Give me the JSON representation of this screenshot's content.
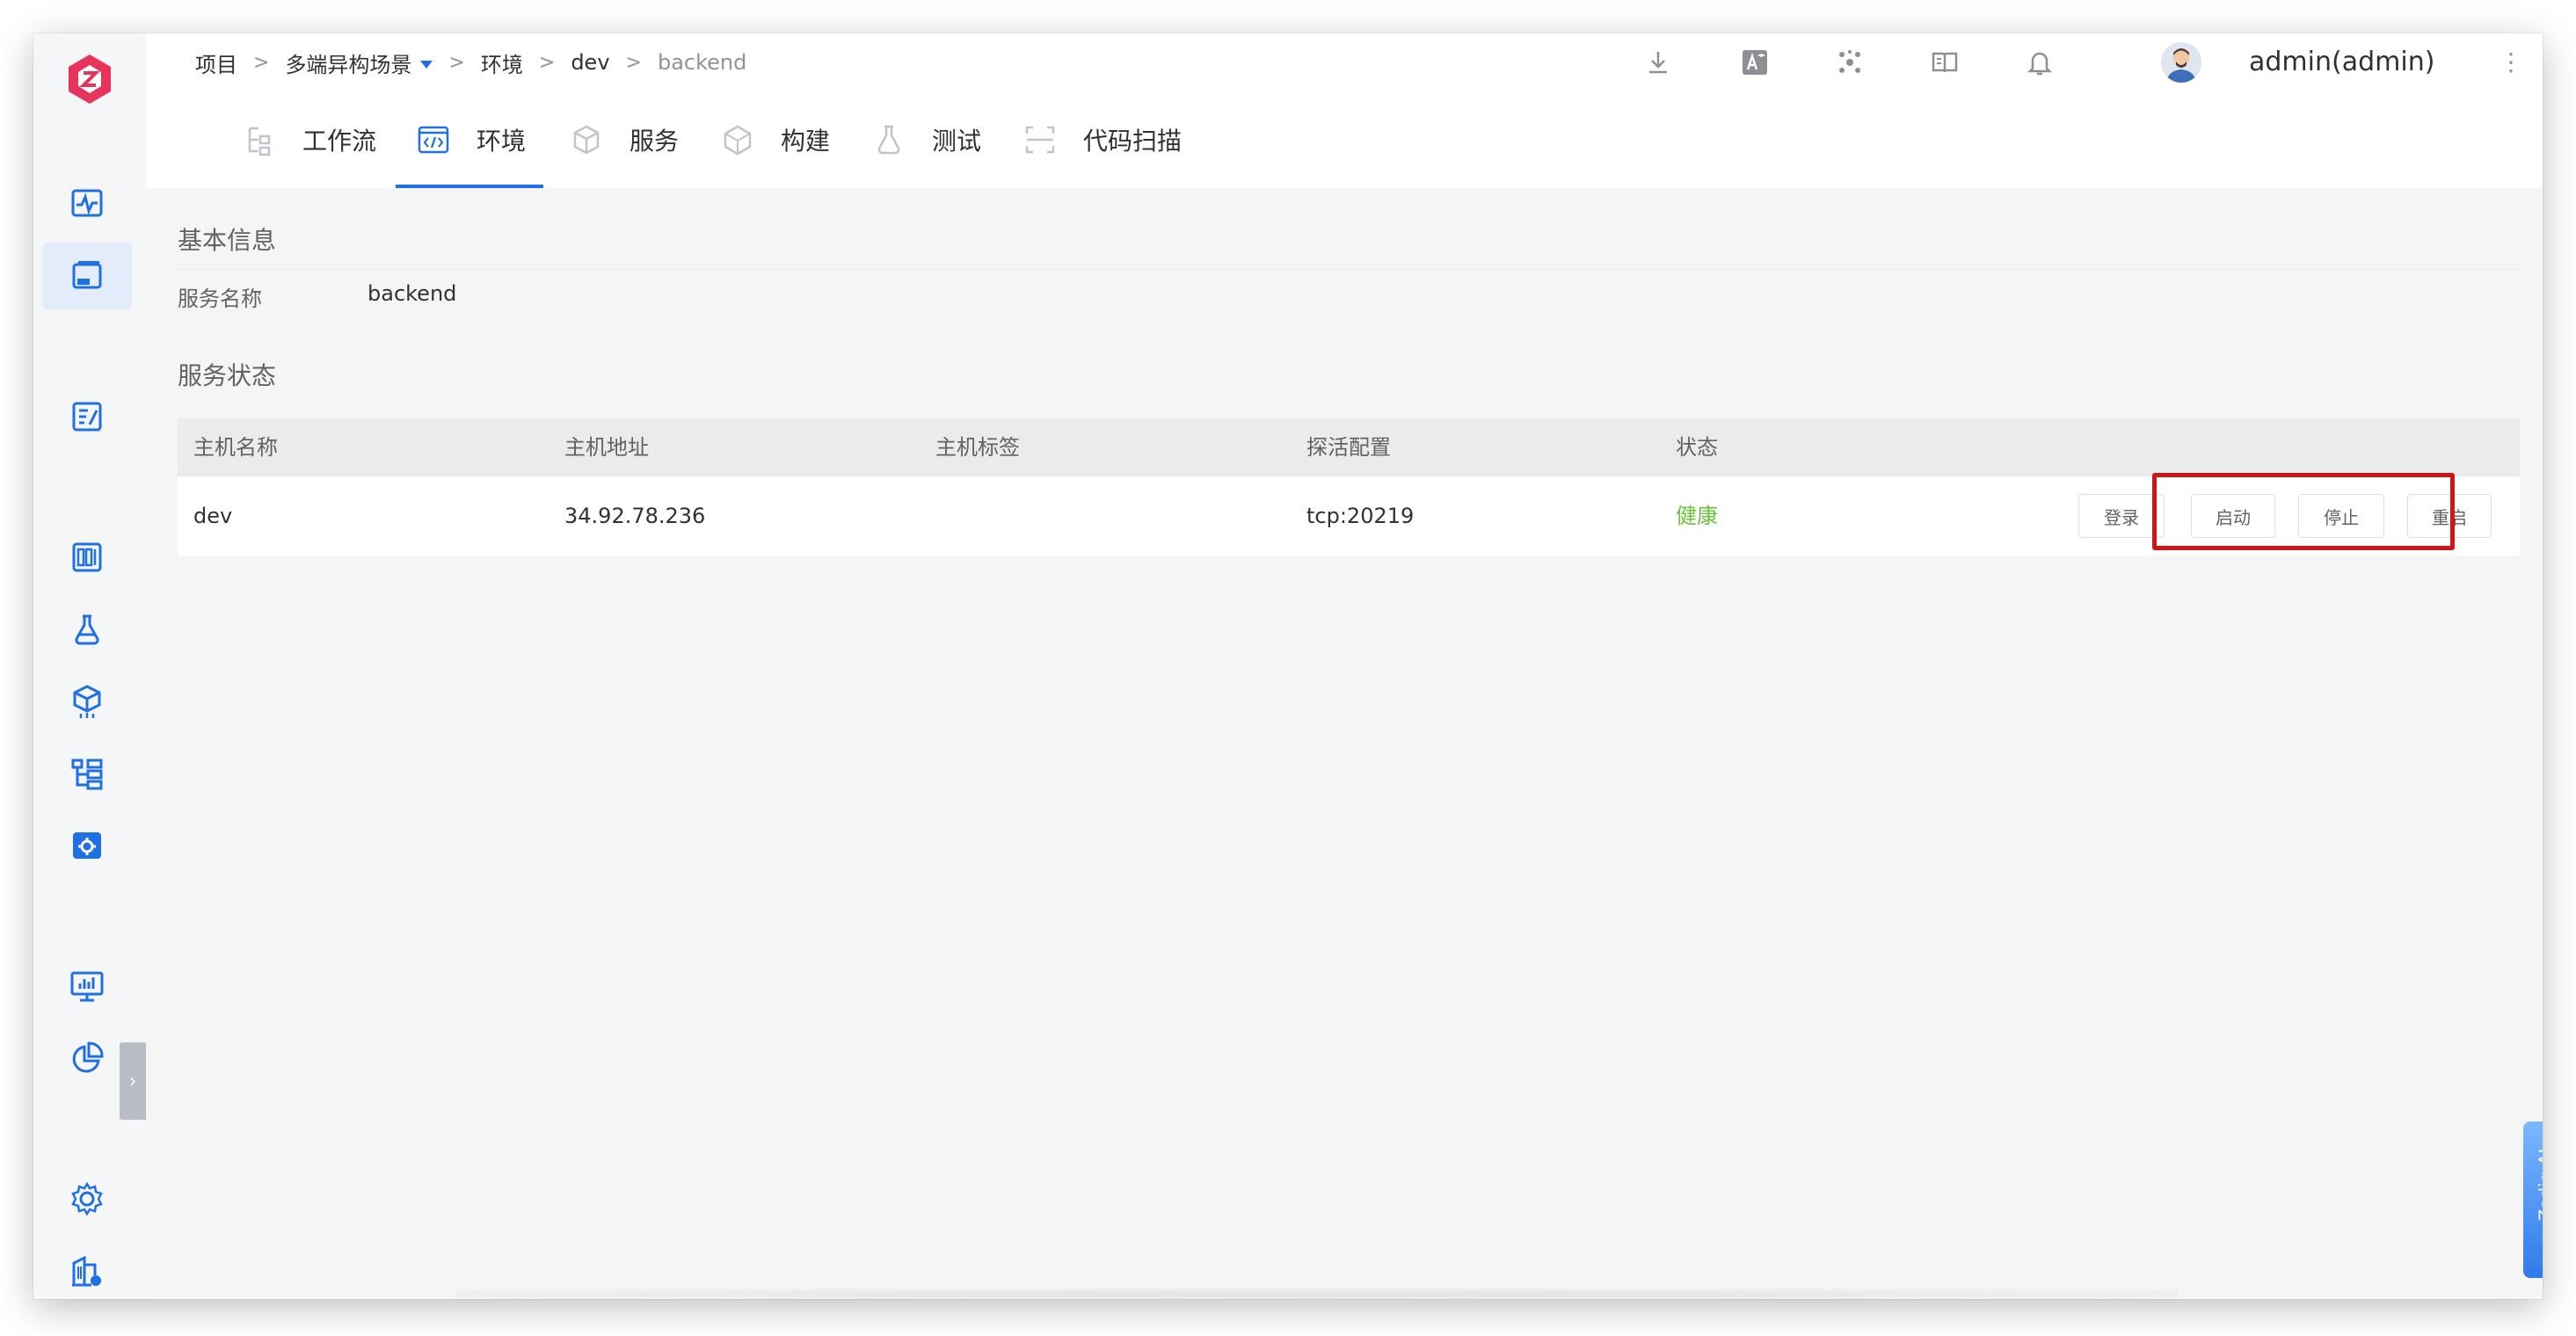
{
  "breadcrumb": {
    "items": [
      "项目",
      "多端异构场景",
      "环境",
      "dev",
      "backend"
    ],
    "separator": ">"
  },
  "header": {
    "username": "admin(admin)",
    "icons": [
      "download-icon",
      "translate-icon",
      "network-icon",
      "docs-icon",
      "bell-icon"
    ]
  },
  "tabs": [
    {
      "label": "工作流",
      "icon": "workflow-icon",
      "active": false
    },
    {
      "label": "环境",
      "icon": "environment-icon",
      "active": true
    },
    {
      "label": "服务",
      "icon": "service-icon",
      "active": false
    },
    {
      "label": "构建",
      "icon": "build-icon",
      "active": false
    },
    {
      "label": "测试",
      "icon": "test-icon",
      "active": false
    },
    {
      "label": "代码扫描",
      "icon": "code-scan-icon",
      "active": false
    }
  ],
  "basic_info": {
    "title": "基本信息",
    "service_name_label": "服务名称",
    "service_name_value": "backend"
  },
  "service_status": {
    "title": "服务状态",
    "columns": [
      "主机名称",
      "主机地址",
      "主机标签",
      "探活配置",
      "状态"
    ],
    "rows": [
      {
        "host_name": "dev",
        "host_address": "34.92.78.236",
        "host_tags": "",
        "probe": "tcp:20219",
        "status": "健康"
      }
    ],
    "actions": {
      "login": "登录",
      "start": "启动",
      "stop": "停止",
      "restart": "重启"
    }
  },
  "ai_tab": {
    "label": "Zadig AI"
  },
  "colors": {
    "accent": "#1f6fe5",
    "healthy": "#67c23a",
    "highlight": "#d0141a",
    "logo": "#e8335b"
  }
}
